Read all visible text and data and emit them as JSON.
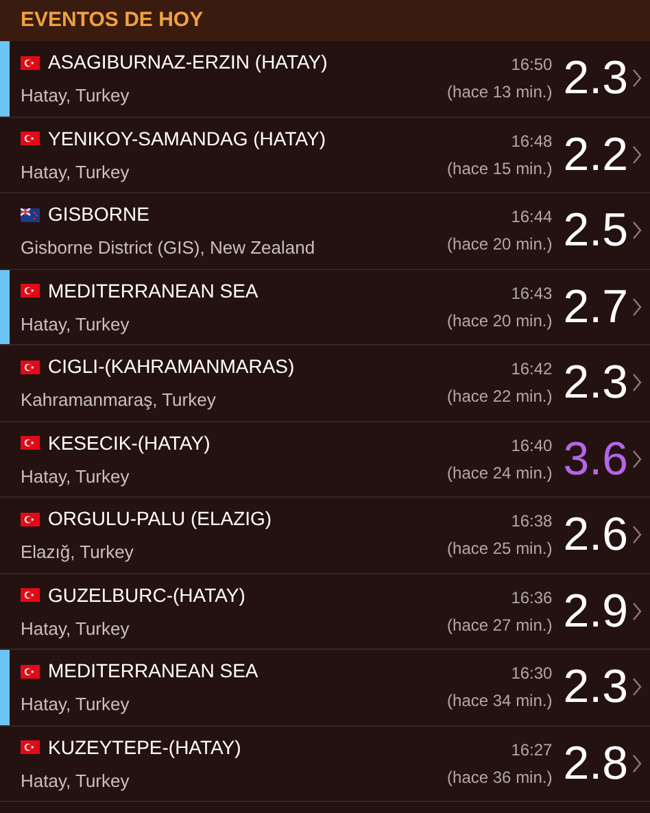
{
  "header": {
    "title": "EVENTOS DE HOY"
  },
  "events": [
    {
      "kind": "turkey",
      "name": "ASAGIBURNAZ-ERZIN (HATAY)",
      "region": "Hatay, Turkey",
      "time": "16:50",
      "ago": "(hace 13 min.)",
      "magnitude": "2.3",
      "color": "#ffffff",
      "marked": true
    },
    {
      "kind": "turkey",
      "name": "YENIKOY-SAMANDAG (HATAY)",
      "region": "Hatay, Turkey",
      "time": "16:48",
      "ago": "(hace 15 min.)",
      "magnitude": "2.2",
      "color": "#ffffff",
      "marked": false
    },
    {
      "kind": "newzealand",
      "name": "GISBORNE",
      "region": "Gisborne District (GIS), New Zealand",
      "time": "16:44",
      "ago": "(hace 20 min.)",
      "magnitude": "2.5",
      "color": "#ffffff",
      "marked": false
    },
    {
      "kind": "turkey",
      "name": "MEDITERRANEAN SEA",
      "region": "Hatay, Turkey",
      "time": "16:43",
      "ago": "(hace 20 min.)",
      "magnitude": "2.7",
      "color": "#ffffff",
      "marked": true
    },
    {
      "kind": "turkey",
      "name": "CIGLI-(KAHRAMANMARAS)",
      "region": "Kahramanmaraş, Turkey",
      "time": "16:42",
      "ago": "(hace 22 min.)",
      "magnitude": "2.3",
      "color": "#ffffff",
      "marked": false
    },
    {
      "kind": "turkey",
      "name": "KESECIK-(HATAY)",
      "region": "Hatay, Turkey",
      "time": "16:40",
      "ago": "(hace 24 min.)",
      "magnitude": "3.6",
      "color": "#b366e6",
      "marked": false
    },
    {
      "kind": "turkey",
      "name": "ORGULU-PALU (ELAZIG)",
      "region": "Elazığ, Turkey",
      "time": "16:38",
      "ago": "(hace 25 min.)",
      "magnitude": "2.6",
      "color": "#ffffff",
      "marked": false
    },
    {
      "kind": "turkey",
      "name": "GUZELBURC-(HATAY)",
      "region": "Hatay, Turkey",
      "time": "16:36",
      "ago": "(hace 27 min.)",
      "magnitude": "2.9",
      "color": "#ffffff",
      "marked": false
    },
    {
      "kind": "turkey",
      "name": "MEDITERRANEAN SEA",
      "region": "Hatay, Turkey",
      "time": "16:30",
      "ago": "(hace 34 min.)",
      "magnitude": "2.3",
      "color": "#ffffff",
      "marked": true
    },
    {
      "kind": "turkey",
      "name": "KUZEYTEPE-(HATAY)",
      "region": "Hatay, Turkey",
      "time": "16:27",
      "ago": "(hace 36 min.)",
      "magnitude": "2.8",
      "color": "#ffffff",
      "marked": false
    }
  ]
}
